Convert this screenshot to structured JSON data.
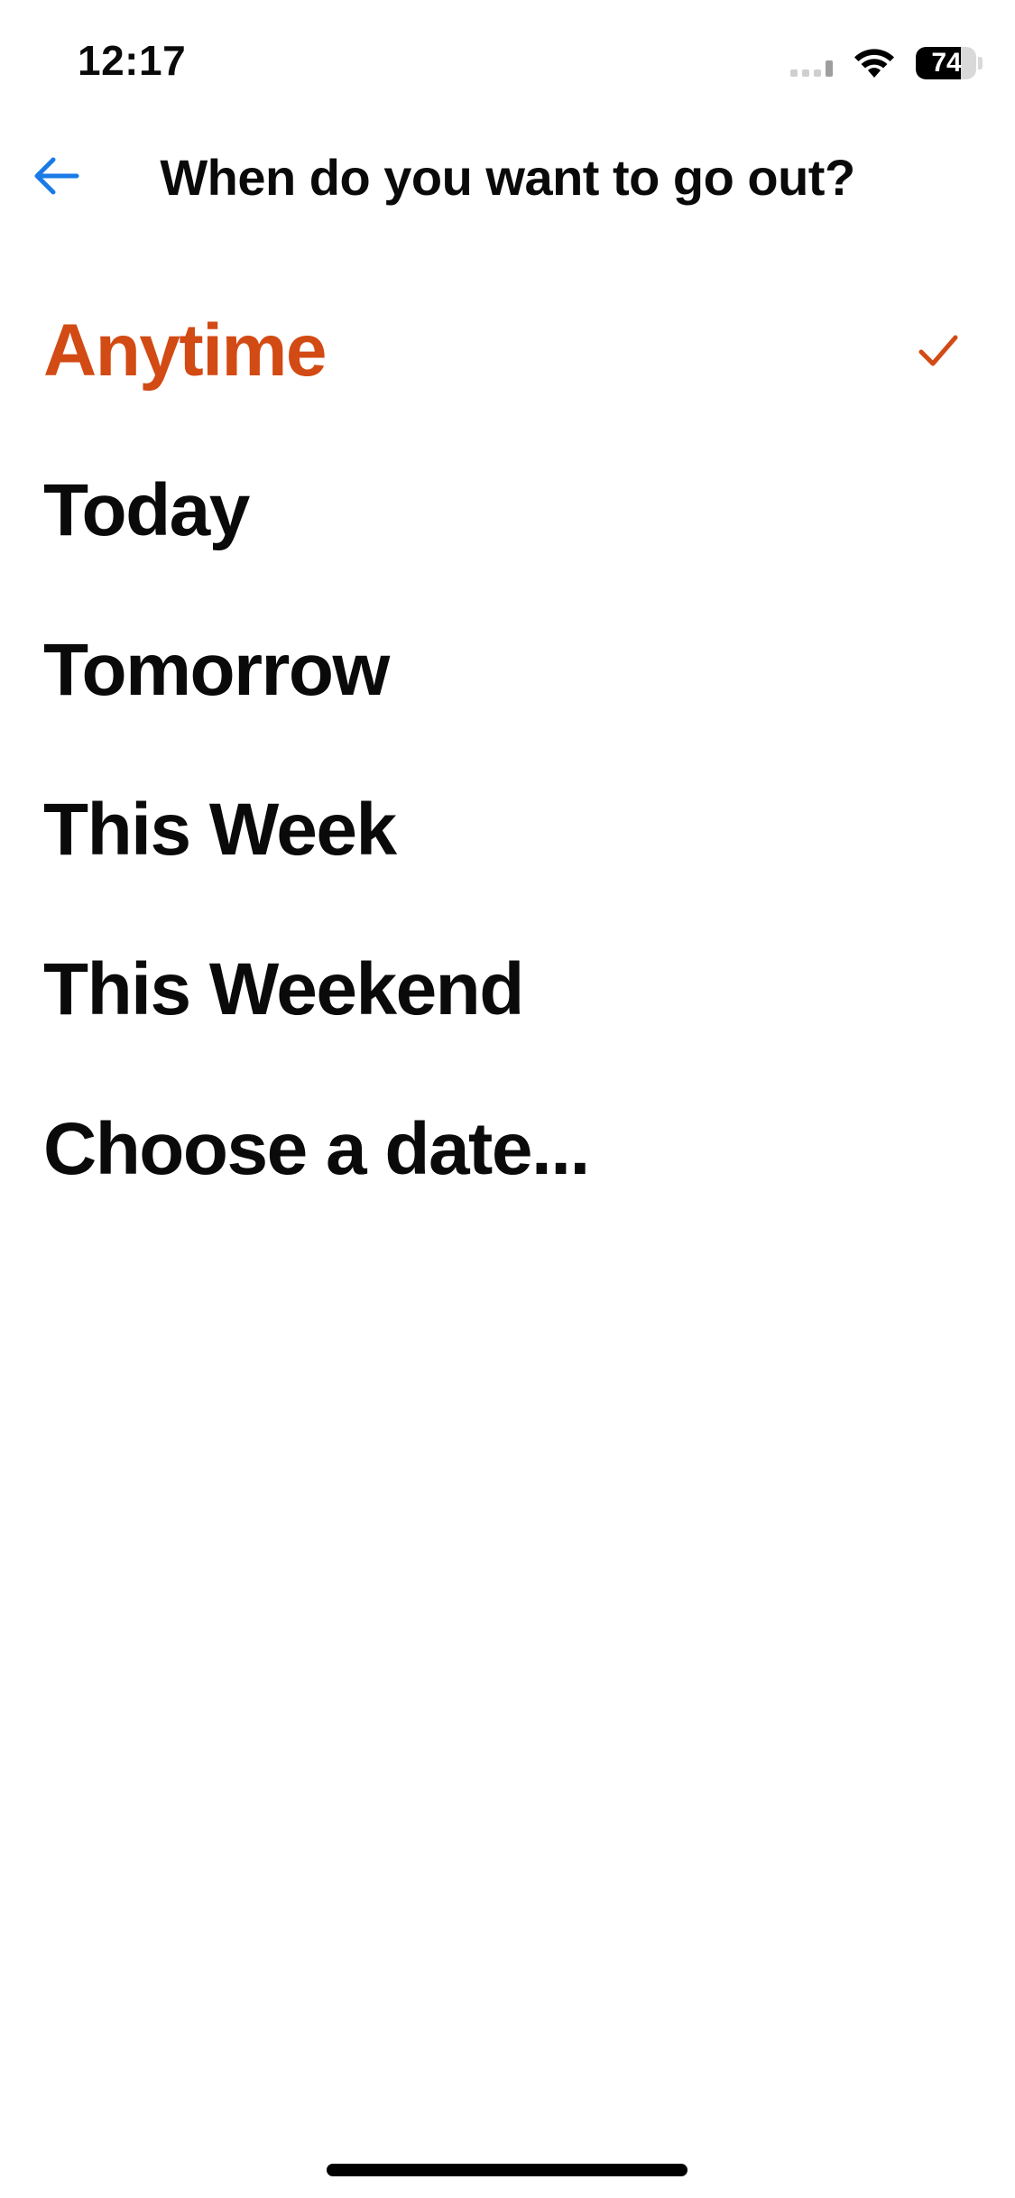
{
  "status_bar": {
    "time": "12:17",
    "battery_level": "74",
    "battery_fraction": 0.74
  },
  "header": {
    "back_icon": "arrow-left-icon",
    "title": "When do you want to go out?"
  },
  "options": [
    {
      "label": "Anytime",
      "selected": true
    },
    {
      "label": "Today",
      "selected": false
    },
    {
      "label": "Tomorrow",
      "selected": false
    },
    {
      "label": "This Week",
      "selected": false
    },
    {
      "label": "This Weekend",
      "selected": false
    },
    {
      "label": "Choose a date...",
      "selected": false
    }
  ],
  "colors": {
    "accent": "#D24A14",
    "back_arrow": "#1A7BE6",
    "text": "#0A0A0A"
  }
}
